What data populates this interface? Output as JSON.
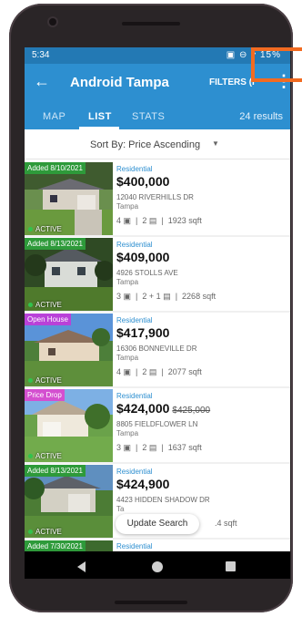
{
  "status_bar": {
    "time": "5:34",
    "icons": "▣ ⊖ ▾ 15%"
  },
  "appbar": {
    "title": "Android Tampa",
    "filters_label": "FILTERS (I",
    "back_icon": "arrow-left-icon",
    "menu_icon": "more-vertical-icon"
  },
  "tabs": [
    {
      "label": "MAP"
    },
    {
      "label": "LIST"
    },
    {
      "label": "STATS"
    }
  ],
  "results": "24 results",
  "sort": {
    "label": "Sort By: Price Ascending"
  },
  "listings": [
    {
      "badge": "Added 8/10/2021",
      "badge_color": "#2e9a3a",
      "status": "ACTIVE",
      "type": "Residential",
      "price": "$400,000",
      "old_price": "",
      "address": "12040 RIVERHILLS DR",
      "city": "Tampa",
      "beds": "4",
      "baths": "2",
      "sqft": "1923 sqft"
    },
    {
      "badge": "Added 8/13/2021",
      "badge_color": "#2e9a3a",
      "status": "ACTIVE",
      "type": "Residential",
      "price": "$409,000",
      "old_price": "",
      "address": "4926 STOLLS AVE",
      "city": "Tampa",
      "beds": "3",
      "baths": "2 + 1",
      "sqft": "2268 sqft"
    },
    {
      "badge": "Open House",
      "badge_color": "#b941d8",
      "status": "ACTIVE",
      "type": "Residential",
      "price": "$417,900",
      "old_price": "",
      "address": "16306 BONNEVILLE DR",
      "city": "Tampa",
      "beds": "4",
      "baths": "2",
      "sqft": "2077 sqft"
    },
    {
      "badge": "Price Drop",
      "badge_color": "#d44fd0",
      "status": "ACTIVE",
      "type": "Residential",
      "price": "$424,000",
      "old_price": "$425,000",
      "address": "8805 FIELDFLOWER LN",
      "city": "Tampa",
      "beds": "3",
      "baths": "2",
      "sqft": "1637 sqft"
    },
    {
      "badge": "Added 8/13/2021",
      "badge_color": "#2e9a3a",
      "status": "ACTIVE",
      "type": "Residential",
      "price": "$424,900",
      "old_price": "",
      "address": "4423 HIDDEN SHADOW DR",
      "city": "Ta",
      "beds": "",
      "baths": "",
      "sqft": ".4 sqft"
    },
    {
      "badge": "Added 7/30/2021",
      "badge_color": "#2e9a3a",
      "status": "",
      "type": "Residential",
      "price": "",
      "old_price": "",
      "address": "",
      "city": "",
      "beds": "",
      "baths": "",
      "sqft": ""
    }
  ],
  "update_button": "Update Search",
  "nav": {
    "back_icon": "nav-back-icon",
    "home_icon": "nav-home-icon",
    "recent_icon": "nav-recents-icon"
  },
  "colors": {
    "primary": "#2d8fd0",
    "status_bar": "#2379b4",
    "highlight": "#f26b21"
  }
}
